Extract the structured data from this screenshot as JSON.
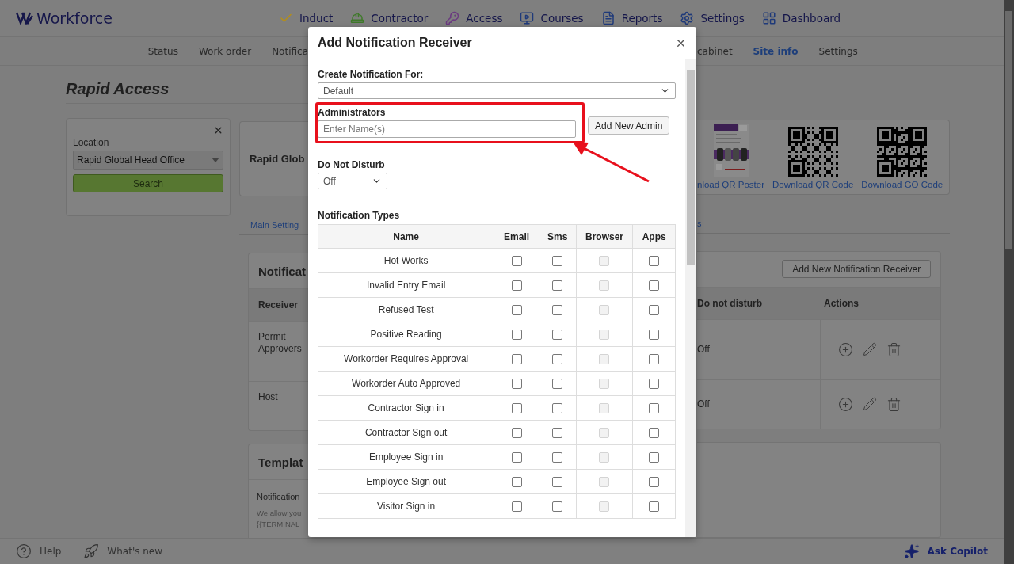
{
  "header": {
    "logo": "Workforce",
    "nav": [
      {
        "label": "Induct"
      },
      {
        "label": "Contractor"
      },
      {
        "label": "Access"
      },
      {
        "label": "Courses"
      },
      {
        "label": "Reports"
      },
      {
        "label": "Settings"
      },
      {
        "label": "Dashboard"
      }
    ]
  },
  "subnav_left": [
    {
      "label": "Status",
      "selected": false
    },
    {
      "label": "Work order",
      "selected": false
    },
    {
      "label": "Notifica",
      "selected": false
    }
  ],
  "subnav_right": [
    {
      "label": "cabinet",
      "selected": false
    },
    {
      "label": "Site info",
      "selected": true
    },
    {
      "label": "Settings",
      "selected": false
    }
  ],
  "page": {
    "title": "Rapid Access",
    "location": {
      "label": "Location",
      "value": "Rapid Global Head Office",
      "search": "Search"
    },
    "site_name": "Rapid Glob",
    "downloads": [
      {
        "label": "nload QR Poster",
        "kind": "poster"
      },
      {
        "label": "Download QR Code",
        "kind": "qr"
      },
      {
        "label": "Download GO Code",
        "kind": "qr"
      }
    ],
    "tabs_left": "Main Setting",
    "tabs_right": "s",
    "notifications": {
      "title": "Notificat",
      "add_button": "Add New Notification Receiver",
      "receiver_column": "Receiver",
      "dnd_column": "Do not disturb",
      "actions_column": "Actions",
      "rows": [
        {
          "receiver": "Permit Approvers",
          "dnd": "Off"
        },
        {
          "receiver": "Host",
          "dnd": "Off"
        }
      ]
    },
    "template": {
      "title": "Templat",
      "label": "Notification",
      "lines": [
        "We allow you",
        "{{TERMINAL"
      ]
    }
  },
  "modal": {
    "title": "Add Notification Receiver",
    "create_for": {
      "label": "Create Notification For:",
      "value": "Default"
    },
    "administrators": {
      "label": "Administrators",
      "placeholder": "Enter Name(s)",
      "highlighted": true
    },
    "add_admin": "Add New Admin",
    "do_not_disturb": {
      "label": "Do Not Disturb",
      "value": "Off"
    },
    "types": {
      "label": "Notification Types",
      "columns": [
        "Name",
        "Email",
        "Sms",
        "Browser",
        "Apps"
      ],
      "rows": [
        {
          "name": "Hot Works",
          "checks": [
            {
              "checked": false,
              "disabled": false
            },
            {
              "checked": false,
              "disabled": false
            },
            {
              "checked": false,
              "disabled": true
            },
            {
              "checked": false,
              "disabled": false
            }
          ]
        },
        {
          "name": "Invalid Entry Email",
          "checks": [
            {
              "checked": false,
              "disabled": false
            },
            {
              "checked": false,
              "disabled": false
            },
            {
              "checked": false,
              "disabled": true
            },
            {
              "checked": false,
              "disabled": false
            }
          ]
        },
        {
          "name": "Refused Test",
          "checks": [
            {
              "checked": false,
              "disabled": false
            },
            {
              "checked": false,
              "disabled": false
            },
            {
              "checked": false,
              "disabled": true
            },
            {
              "checked": false,
              "disabled": false
            }
          ]
        },
        {
          "name": "Positive Reading",
          "checks": [
            {
              "checked": false,
              "disabled": false
            },
            {
              "checked": false,
              "disabled": false
            },
            {
              "checked": false,
              "disabled": true
            },
            {
              "checked": false,
              "disabled": false
            }
          ]
        },
        {
          "name": "Workorder Requires Approval",
          "checks": [
            {
              "checked": false,
              "disabled": false
            },
            {
              "checked": false,
              "disabled": false
            },
            {
              "checked": false,
              "disabled": true
            },
            {
              "checked": false,
              "disabled": false
            }
          ]
        },
        {
          "name": "Workorder Auto Approved",
          "checks": [
            {
              "checked": false,
              "disabled": false
            },
            {
              "checked": false,
              "disabled": false
            },
            {
              "checked": false,
              "disabled": true
            },
            {
              "checked": false,
              "disabled": false
            }
          ]
        },
        {
          "name": "Contractor Sign in",
          "checks": [
            {
              "checked": false,
              "disabled": false
            },
            {
              "checked": false,
              "disabled": false
            },
            {
              "checked": false,
              "disabled": true
            },
            {
              "checked": false,
              "disabled": false
            }
          ]
        },
        {
          "name": "Contractor Sign out",
          "checks": [
            {
              "checked": false,
              "disabled": false
            },
            {
              "checked": false,
              "disabled": false
            },
            {
              "checked": false,
              "disabled": true
            },
            {
              "checked": false,
              "disabled": false
            }
          ]
        },
        {
          "name": "Employee Sign in",
          "checks": [
            {
              "checked": false,
              "disabled": false
            },
            {
              "checked": false,
              "disabled": false
            },
            {
              "checked": false,
              "disabled": true
            },
            {
              "checked": false,
              "disabled": false
            }
          ]
        },
        {
          "name": "Employee Sign out",
          "checks": [
            {
              "checked": false,
              "disabled": false
            },
            {
              "checked": false,
              "disabled": false
            },
            {
              "checked": false,
              "disabled": true
            },
            {
              "checked": false,
              "disabled": false
            }
          ]
        },
        {
          "name": "Visitor Sign in",
          "checks": [
            {
              "checked": false,
              "disabled": false
            },
            {
              "checked": false,
              "disabled": false
            },
            {
              "checked": false,
              "disabled": true
            },
            {
              "checked": false,
              "disabled": false
            }
          ]
        }
      ]
    }
  },
  "footer": {
    "help": "Help",
    "whats_new": "What's new",
    "copilot": "Ask Copilot"
  }
}
